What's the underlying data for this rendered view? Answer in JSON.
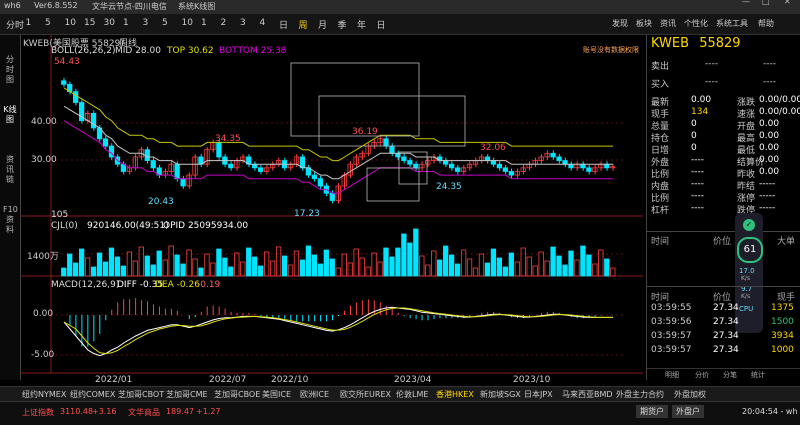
{
  "titlebar": {
    "app": "wh6",
    "version": "Ver6.8.552",
    "server": "文华云节点-四川电信",
    "mode": "系统K线图"
  },
  "toolbar": {
    "periods": [
      "分时",
      "1",
      "5",
      "10",
      "15",
      "30",
      "1",
      "3",
      "5",
      "10",
      "1",
      "2",
      "3",
      "4",
      "日",
      "周",
      "月",
      "季",
      "年",
      "日"
    ],
    "right_menu": [
      "发现",
      "板块",
      "资讯",
      "个性化",
      "系统工具",
      "帮助"
    ],
    "window_controls": [
      "—",
      "□",
      "✕"
    ]
  },
  "left_tabs": [
    "分时图",
    "K线图",
    "资讯链",
    "F10资料"
  ],
  "chart": {
    "header_code": "KWEB(美国股票 55829)",
    "header_period": "周线",
    "boll_label": "BOLL(26,26,2)",
    "mid": "MID 28.00",
    "top": "TOP 30.62",
    "bottom": "BOTTOM 25.38",
    "permission": "账号没有数据权限",
    "cjl_label": "CJL(0)",
    "cjl_vals": "920146.00(49:51)",
    "opid": "OPID 25095934.00",
    "macd_label": "MACD(12,26,9)",
    "diff": "DIFF -0.35",
    "dea": "DEA -0.26",
    "macd_val": "-0.19",
    "bar_count": "105",
    "y_price_ticks": [
      "40.00",
      "30.00"
    ],
    "y_vol_tick": "1400万",
    "y_macd_ticks": [
      "0.00",
      "-5.00"
    ],
    "x_ticks": [
      "2022/01",
      "2022/07",
      "2022/10",
      "2023/04",
      "2023/10"
    ],
    "annotations": [
      "54.43",
      "34.35",
      "36.19",
      "20.43",
      "17.23",
      "24.35",
      "32.06"
    ]
  },
  "chart_data": {
    "type": "candlestick",
    "period": "weekly",
    "price_ylim": [
      14,
      57
    ],
    "candles_close": [
      50,
      48,
      45,
      40,
      42,
      38,
      35,
      33,
      30,
      28,
      26,
      27,
      30,
      32,
      29,
      27,
      25,
      26,
      28,
      24,
      22,
      25,
      30,
      28,
      32,
      34,
      30,
      28,
      27,
      29,
      30,
      28,
      27,
      26,
      27,
      28,
      29,
      27,
      28,
      30,
      27,
      25,
      24,
      22,
      20,
      18,
      22,
      25,
      28,
      30,
      31,
      33,
      34,
      35,
      33,
      31,
      30,
      29,
      28,
      27,
      28,
      29,
      30,
      29,
      28,
      27,
      26,
      27,
      28,
      29,
      30,
      29,
      28,
      27,
      26,
      25,
      26,
      27,
      28,
      29,
      30,
      31,
      30,
      29,
      28,
      27,
      28,
      27,
      26,
      27,
      28,
      27,
      27.3
    ],
    "boll_mid": [
      44,
      43,
      42,
      41,
      40,
      39,
      38,
      36,
      35,
      33,
      32,
      31,
      31,
      31,
      30,
      30,
      29,
      29,
      29,
      28,
      28,
      28,
      28,
      28,
      29,
      29,
      29,
      29,
      29,
      29,
      29,
      28,
      28,
      28,
      28,
      28,
      28,
      28,
      28,
      28,
      27,
      27,
      26,
      25,
      25,
      24,
      24,
      25,
      26,
      27,
      28,
      29,
      30,
      31,
      31,
      31,
      31,
      31,
      31,
      30,
      30,
      30,
      30,
      29,
      29,
      29,
      29,
      29,
      29,
      29,
      29,
      29,
      29,
      29,
      29,
      28,
      28,
      28,
      28,
      28,
      28,
      28,
      28,
      28,
      28,
      28,
      28,
      28,
      28,
      28,
      28,
      28,
      28
    ],
    "macd_diff": [
      -1,
      -2,
      -3,
      -4,
      -5,
      -5.5,
      -5.8,
      -5.5,
      -5,
      -4.6,
      -4,
      -3.5,
      -3,
      -2.6,
      -2.2,
      -2,
      -1.8,
      -1.6,
      -1.4,
      -1.4,
      -1.6,
      -1.8,
      -1.6,
      -1.3,
      -1,
      -0.7,
      -0.5,
      -0.4,
      -0.4,
      -0.3,
      -0.2,
      -0.2,
      -0.2,
      -0.3,
      -0.4,
      -0.5,
      -0.6,
      -0.8,
      -1,
      -1.2,
      -1.4,
      -1.6,
      -1.8,
      -2,
      -2.2,
      -2.3,
      -2.1,
      -1.8,
      -1.4,
      -0.9,
      -0.4,
      0.1,
      0.5,
      0.8,
      1,
      1.1,
      1,
      0.9,
      0.8,
      0.6,
      0.4,
      0.3,
      0.2,
      0.1,
      0,
      -0.1,
      -0.2,
      -0.3,
      -0.3,
      -0.2,
      -0.1,
      0,
      0.1,
      0.1,
      0,
      -0.1,
      -0.2,
      -0.3,
      -0.3,
      -0.2,
      -0.1,
      0,
      0.1,
      0.1,
      0,
      -0.1,
      -0.2,
      -0.3,
      -0.35,
      -0.35,
      -0.35,
      -0.35,
      -0.35
    ]
  },
  "quote": {
    "symbol": "KWEB",
    "code": "55829",
    "sell_label": "卖出",
    "sell_price": "----",
    "sell_vol": "----",
    "buy_label": "买入",
    "buy_price": "----",
    "buy_vol": "----",
    "left_labels": [
      "最新",
      "现手",
      "总量",
      "持仓",
      "日增",
      "外盘",
      "比例",
      "内盘",
      "比例",
      "杠杆"
    ],
    "left_values": [
      "0.00",
      "134",
      "0",
      "0",
      "0",
      "----",
      "----",
      "----",
      "----",
      "----"
    ],
    "right_labels": [
      "涨跌",
      "速涨",
      "开盘",
      "最高",
      "最低",
      "结算价",
      "昨收",
      "昨结",
      "涨停",
      "跌停"
    ],
    "right_values": [
      "0.00/0.00%",
      "0.00/0.00%",
      "0.00",
      "0.00",
      "0.00",
      "0.00",
      "0.00",
      "-----",
      "-----",
      "-----"
    ],
    "tick_header": [
      "时间",
      "价位",
      "大单"
    ],
    "trade_header": [
      "时间",
      "价位",
      "现手"
    ],
    "trades": [
      {
        "time": "03:59:55",
        "price": "27.34",
        "vol": "1375"
      },
      {
        "time": "03:59:56",
        "price": "27.34",
        "vol": "1500"
      },
      {
        "time": "03:59:57",
        "price": "27.34",
        "vol": "3934"
      },
      {
        "time": "03:59:57",
        "price": "27.34",
        "vol": "1000"
      }
    ],
    "widget": {
      "pct": "61",
      "unit": "%",
      "up": "17.0",
      "up_unit": "K/s",
      "down": "9.7",
      "down_unit": "K/s",
      "cpu": "CPU"
    },
    "bottom_tabs": [
      "明细",
      "分价",
      "分笔",
      "统计"
    ]
  },
  "bottom_tabs": [
    "纽约NYMEX",
    "纽约COMEX",
    "芝加哥CBOT",
    "芝加哥CME",
    "芝加哥CBOE",
    "美国ICE",
    "欧洲ICE",
    "欧交所EUREX",
    "伦敦LME",
    "香港HKEX",
    "新加坡SGX",
    "日本JPX",
    "马来西亚BMD",
    "外盘主力合约",
    "外盘加权"
  ],
  "active_bottom_tab": "香港HKEX",
  "status": {
    "index1_name": "上证指数",
    "index1_val": "3110.48",
    "index1_chg": "+3.16",
    "index2_name": "文华商品",
    "index2_val": "189.47",
    "index2_chg": "+1.27",
    "btn1": "期货户",
    "btn2": "外盘户",
    "time": "20:04:54 - wh"
  },
  "colors": {
    "up": "#ff4040",
    "down": "#00e5ff",
    "boll_mid": "#c8c8c8",
    "boll_top": "#c8c800",
    "boll_bottom": "#c800c8",
    "accent": "#ffd700"
  }
}
